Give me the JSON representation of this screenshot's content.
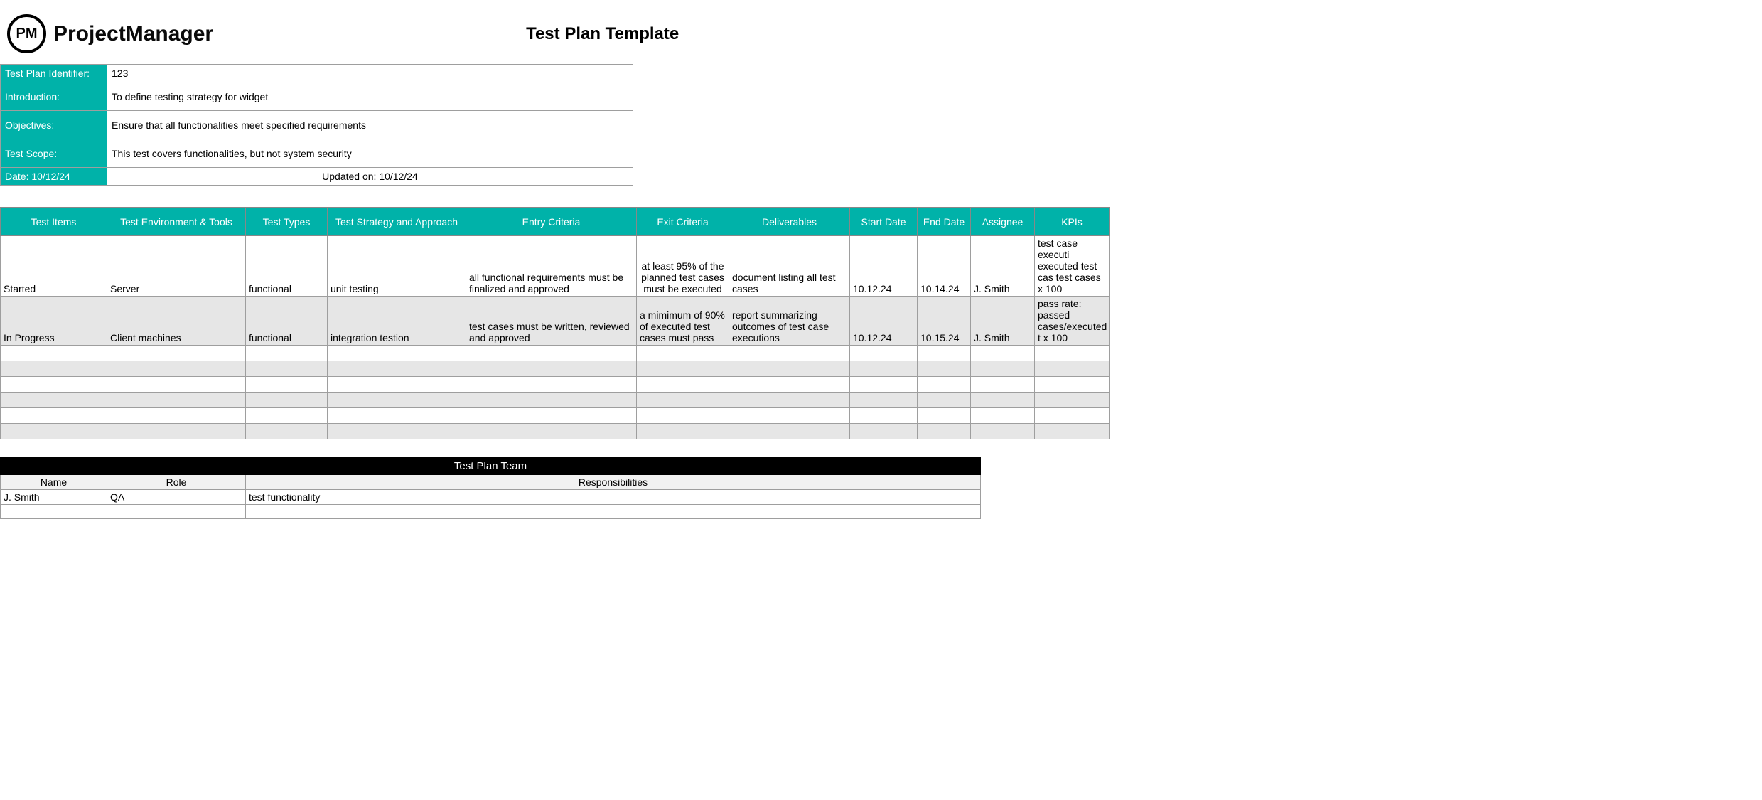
{
  "brand": {
    "logo_text": "PM",
    "name": "ProjectManager"
  },
  "title": "Test Plan Template",
  "meta": {
    "identifier_label": "Test Plan Identifier:",
    "identifier_value": "123",
    "introduction_label": "Introduction:",
    "introduction_value": "To define testing strategy for widget",
    "objectives_label": "Objectives:",
    "objectives_value": "Ensure that all functionalities meet specified requirements",
    "scope_label": "Test Scope:",
    "scope_value": "This test covers functionalities, but not system security",
    "date_label": "Date: 10/12/24",
    "updated_label": "Updated on: 10/12/24"
  },
  "columns": {
    "c0": "Test Items",
    "c1": "Test Environment & Tools",
    "c2": "Test Types",
    "c3": "Test Strategy and Approach",
    "c4": "Entry Criteria",
    "c5": "Exit Criteria",
    "c6": "Deliverables",
    "c7": "Start Date",
    "c8": "End Date",
    "c9": "Assignee",
    "c10": "KPIs"
  },
  "rows": [
    {
      "c0": "Started",
      "c1": "Server",
      "c2": "functional",
      "c3": "unit testing",
      "c4": "all functional requirements must be finalized and approved",
      "c5": "at least 95% of the planned test cases must be executed",
      "c6": "document listing all test cases",
      "c7": "10.12.24",
      "c8": "10.14.24",
      "c9": "J. Smith",
      "c10": "test case executi executed test cas test cases x 100"
    },
    {
      "c0": "In Progress",
      "c1": "Client machines",
      "c2": "functional",
      "c3": "integration testion",
      "c4": "test cases must be written, reviewed and approved",
      "c5": "a mimimum of 90% of executed test cases must pass",
      "c6": "report summarizing outcomes of test case executions",
      "c7": "10.12.24",
      "c8": "10.15.24",
      "c9": "J. Smith",
      "c10": "pass rate: passed cases/executed t x 100"
    }
  ],
  "team": {
    "header": "Test Plan Team",
    "cols": {
      "name": "Name",
      "role": "Role",
      "resp": "Responsibilities"
    },
    "rows": [
      {
        "name": "J. Smith",
        "role": "QA",
        "resp": "test functionality"
      }
    ]
  }
}
